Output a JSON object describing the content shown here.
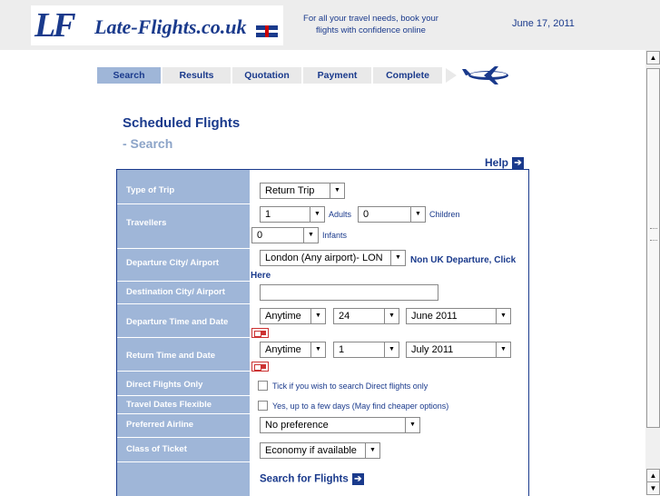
{
  "header": {
    "logo_mark": "LF",
    "logo_text": "Late-Flights.co.uk",
    "tagline": "For all your travel needs, book your flights with confidence online",
    "date": "June 17, 2011"
  },
  "steps": [
    {
      "label": "Search",
      "active": true
    },
    {
      "label": "Results",
      "active": false
    },
    {
      "label": "Quotation",
      "active": false
    },
    {
      "label": "Payment",
      "active": false
    },
    {
      "label": "Complete",
      "active": false
    }
  ],
  "page": {
    "title": "Scheduled Flights",
    "subtitle": "- Search",
    "help": "Help"
  },
  "form": {
    "type_of_trip": {
      "label": "Type of Trip",
      "value": "Return Trip"
    },
    "travellers": {
      "label": "Travellers",
      "adults_value": "1",
      "adults_label": "Adults",
      "children_value": "0",
      "children_label": "Children",
      "infants_value": "0",
      "infants_label": "Infants"
    },
    "departure_city": {
      "label": "Departure City/ Airport",
      "value": "London (Any airport)- LON",
      "link": "Non UK Departure, Click Here"
    },
    "destination_city": {
      "label": "Destination City/ Airport",
      "value": ""
    },
    "departure_time": {
      "label": "Departure Time and Date",
      "time": "Anytime",
      "day": "24",
      "month": "June 2011"
    },
    "return_time": {
      "label": "Return Time and Date",
      "time": "Anytime",
      "day": "1",
      "month": "July 2011"
    },
    "direct_flights": {
      "label": "Direct Flights Only",
      "text": "Tick if you wish to search Direct flights only"
    },
    "flexible_dates": {
      "label": "Travel Dates Flexible",
      "text": "Yes, up to a few days (May find cheaper options)"
    },
    "preferred_airline": {
      "label": "Preferred Airline",
      "value": "No preference"
    },
    "class_of_ticket": {
      "label": "Class of Ticket",
      "value": "Economy if available"
    },
    "search_button": "Search for Flights"
  }
}
